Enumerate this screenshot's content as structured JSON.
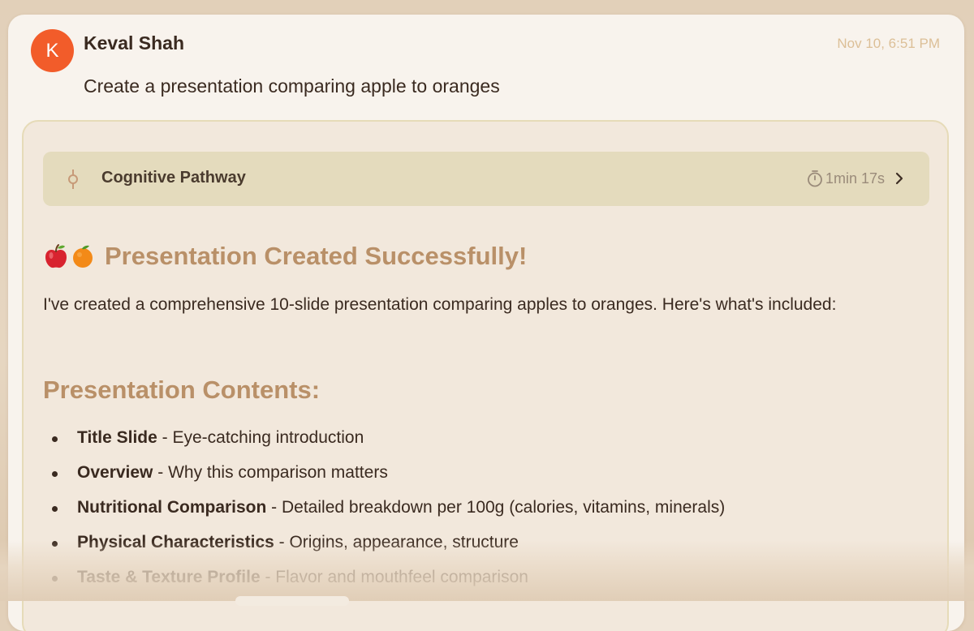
{
  "message": {
    "avatar_initial": "K",
    "user_name": "Keval Shah",
    "timestamp": "Nov 10, 6:51 PM",
    "text": "Create a presentation comparing apple to oranges"
  },
  "response": {
    "pathway": {
      "label": "Cognitive Pathway",
      "duration": "1min 17s",
      "icon": "pathway-node-icon"
    },
    "heading_emoji": "🍎🍊",
    "heading": "Presentation Created Successfully!",
    "intro": "I've created a comprehensive 10-slide presentation comparing apples to oranges. Here's what's included:",
    "section_heading": "Presentation Contents:",
    "items": [
      {
        "title": "Title Slide",
        "description": " - Eye-catching introduction"
      },
      {
        "title": "Overview",
        "description": " - Why this comparison matters"
      },
      {
        "title": "Nutritional Comparison",
        "description": " - Detailed breakdown per 100g (calories, vitamins, minerals)"
      },
      {
        "title": "Physical Characteristics",
        "description": " - Origins, appearance, structure"
      },
      {
        "title": "Taste & Texture Profile",
        "description": " - Flavor and mouthfeel comparison"
      }
    ]
  },
  "colors": {
    "avatar": "#f25c2a",
    "heading": "#b99068",
    "timestamp": "#dcbf97",
    "pathway_bar": "#e4dbbd",
    "card_background": "#f2e8dc"
  }
}
